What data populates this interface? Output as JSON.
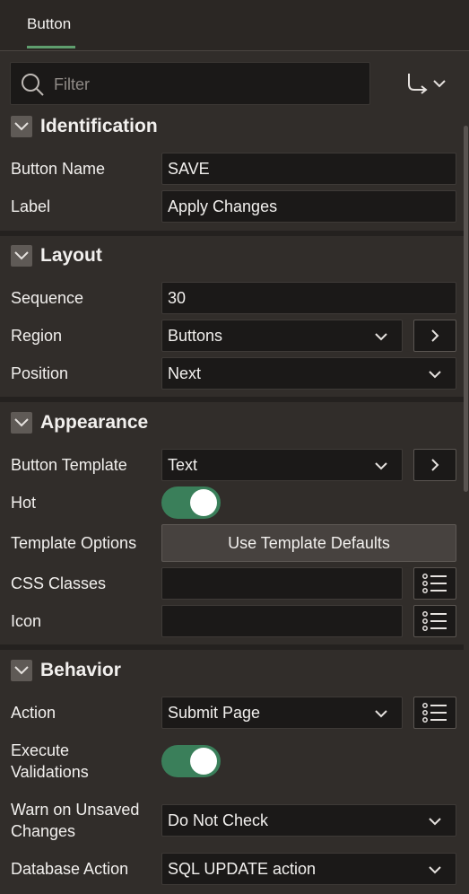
{
  "tab": {
    "label": "Button"
  },
  "filter": {
    "placeholder": "Filter"
  },
  "groups": {
    "identification": {
      "title": "Identification",
      "button_name_label": "Button Name",
      "button_name_value": "SAVE",
      "label_label": "Label",
      "label_value": "Apply Changes"
    },
    "layout": {
      "title": "Layout",
      "sequence_label": "Sequence",
      "sequence_value": "30",
      "region_label": "Region",
      "region_value": "Buttons",
      "position_label": "Position",
      "position_value": "Next"
    },
    "appearance": {
      "title": "Appearance",
      "button_template_label": "Button Template",
      "button_template_value": "Text",
      "hot_label": "Hot",
      "template_options_label": "Template Options",
      "template_options_button": "Use Template Defaults",
      "css_classes_label": "CSS Classes",
      "css_classes_value": "",
      "icon_label": "Icon",
      "icon_value": ""
    },
    "behavior": {
      "title": "Behavior",
      "action_label": "Action",
      "action_value": "Submit Page",
      "execute_validations_label_1": "Execute",
      "execute_validations_label_2": "Validations",
      "warn_label_1": "Warn on Unsaved",
      "warn_label_2": "Changes",
      "warn_value": "Do Not Check",
      "db_action_label": "Database Action",
      "db_action_value": "SQL UPDATE action"
    }
  },
  "colors": {
    "accent": "#5f9e6e",
    "toggle_on": "#3a7f5a",
    "background": "#312d2a",
    "field_bg": "#1b1918"
  }
}
